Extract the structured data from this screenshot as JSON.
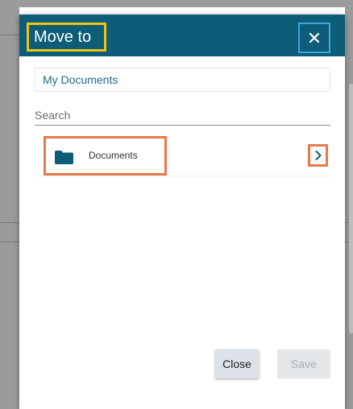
{
  "dialog": {
    "title": "Move to",
    "close_icon": "close-icon",
    "location": "My Documents",
    "search": {
      "placeholder": "Search",
      "value": ""
    },
    "items": [
      {
        "label": "Documents",
        "icon": "folder-icon",
        "expand_icon": "chevron-right-icon"
      }
    ],
    "buttons": {
      "close_label": "Close",
      "save_label": "Save"
    }
  },
  "colors": {
    "header": "#0d5c78",
    "title_highlight": "#f1c40f",
    "close_highlight": "#3fa6e0",
    "item_highlight": "#e8794a",
    "link": "#1d6a8a"
  }
}
